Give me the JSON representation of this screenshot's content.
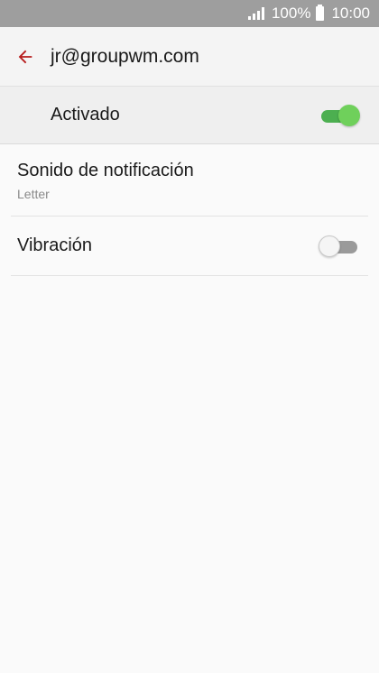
{
  "status_bar": {
    "battery_percent": "100%",
    "time": "10:00",
    "icons": [
      "signal-icon",
      "battery-icon"
    ]
  },
  "app_bar": {
    "title": "jr@groupwm.com",
    "back_icon": "arrow-left-icon",
    "accent_color": "#b71c1c"
  },
  "master_switch": {
    "label": "Activado",
    "enabled": true
  },
  "settings": {
    "sound": {
      "title": "Sonido de notificación",
      "summary": "Letter"
    },
    "vibration": {
      "title": "Vibración",
      "enabled": false
    }
  },
  "colors": {
    "switch_on": "#4caf50",
    "switch_off": "#9a9a9a",
    "status_bar": "#9e9e9e"
  }
}
